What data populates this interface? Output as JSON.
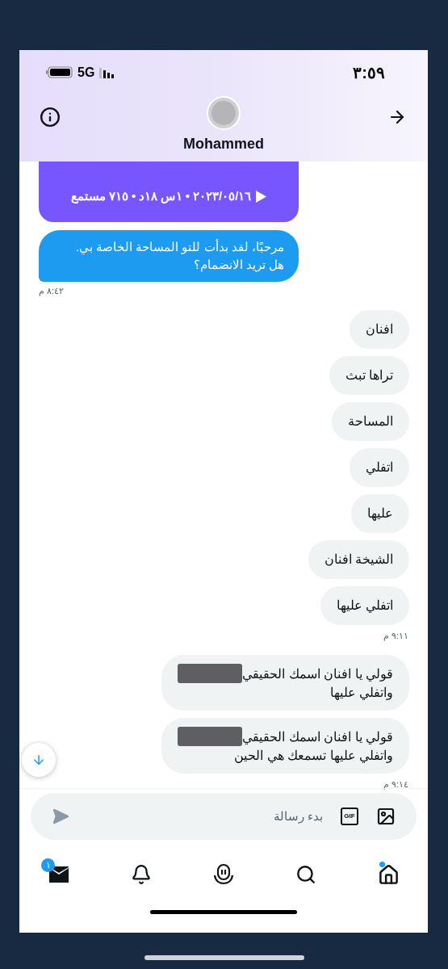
{
  "status_bar": {
    "time": "٣:٥٩",
    "network": "5G"
  },
  "header": {
    "name": "Mohammed"
  },
  "space_card": {
    "meta": "٢٠٢٣/٠٥/١٦ • ١س ١٨د • ٧١٥ مستمع"
  },
  "messages": [
    {
      "kind": "received",
      "lines": [
        "مرحبًا، لقد بدأت للتو المساحة الخاصة بي.",
        "هل تريد الانضمام؟"
      ],
      "redacted": false
    },
    {
      "kind": "received_time",
      "text": "٨:٤٢ م"
    },
    {
      "kind": "sent",
      "lines": [
        "افنان"
      ],
      "redacted": false
    },
    {
      "kind": "sent",
      "lines": [
        "تراها تبث"
      ],
      "redacted": false
    },
    {
      "kind": "sent",
      "lines": [
        "المساحة"
      ],
      "redacted": false
    },
    {
      "kind": "sent",
      "lines": [
        "اتفلي"
      ],
      "redacted": false
    },
    {
      "kind": "sent",
      "lines": [
        "عليها"
      ],
      "redacted": false
    },
    {
      "kind": "sent",
      "lines": [
        "الشيخة افنان"
      ],
      "redacted": false
    },
    {
      "kind": "sent",
      "lines": [
        "اتفلي عليها"
      ],
      "redacted": false
    },
    {
      "kind": "sent_time",
      "text": "٩:١١ م"
    },
    {
      "kind": "sent",
      "lines": [
        "قولي يا افنان اسمك الحقيقي",
        "واتفلي عليها"
      ],
      "redacted": true
    },
    {
      "kind": "sent",
      "lines": [
        "قولي يا افنان اسمك الحقيقي",
        "واتفلي عليها تسمعك هي الحين"
      ],
      "redacted": true
    },
    {
      "kind": "sent_time",
      "text": "٩:١٤ م"
    }
  ],
  "composer": {
    "placeholder": "بدء رسالة",
    "gif_label": "GIF"
  },
  "nav": [
    {
      "kind": "mail",
      "badge": "١",
      "dot": false
    },
    {
      "kind": "bell",
      "dot": false
    },
    {
      "kind": "spaces",
      "dot": false
    },
    {
      "kind": "search",
      "dot": false
    },
    {
      "kind": "home",
      "dot": true
    }
  ]
}
